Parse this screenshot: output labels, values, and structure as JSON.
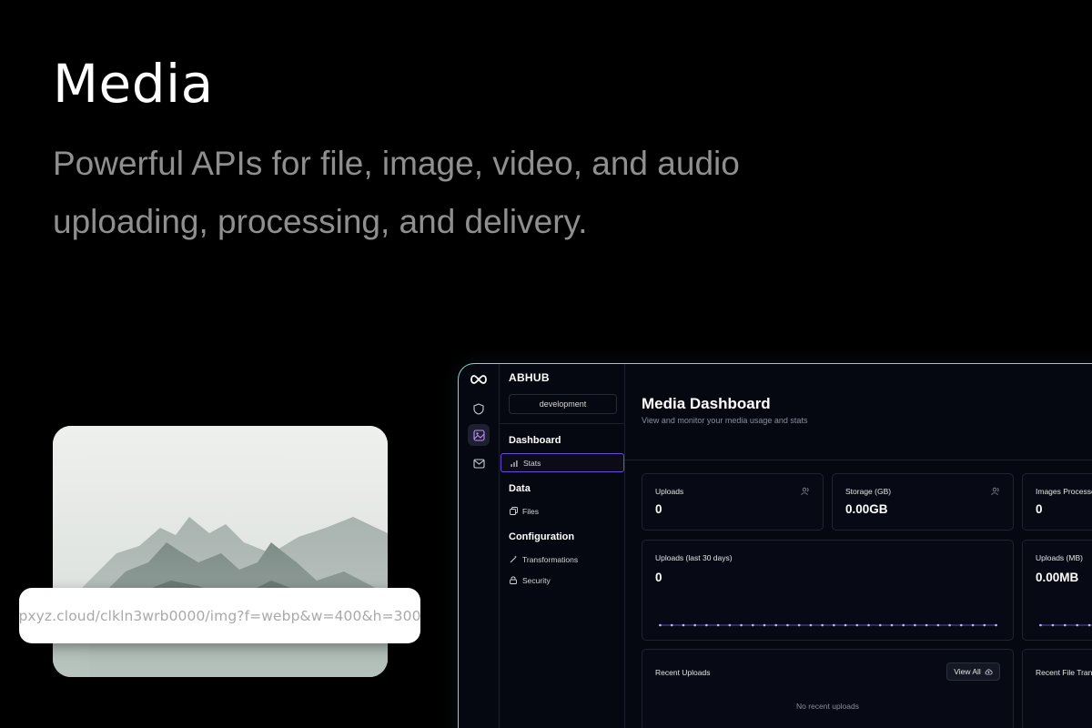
{
  "hero": {
    "title": "Media",
    "subtitle": "Powerful APIs for file, image, video, and audio uploading, processing, and delivery."
  },
  "image_card": {
    "url": "pxyz.cloud/clkln3wrb0000/img?f=webp&w=400&h=300"
  },
  "app": {
    "rail_icons": [
      "infinity-logo-icon",
      "shield-icon",
      "image-icon",
      "mail-icon"
    ],
    "org_name": "ABHUB",
    "environment": "development",
    "sidebar": {
      "dashboard_title": "Dashboard",
      "stats_label": "Stats",
      "data_title": "Data",
      "files_label": "Files",
      "config_title": "Configuration",
      "transformations_label": "Transformations",
      "security_label": "Security"
    },
    "main": {
      "title": "Media Dashboard",
      "subtitle": "View and monitor your media usage and stats",
      "stats": [
        {
          "label": "Uploads",
          "value": "0"
        },
        {
          "label": "Storage (GB)",
          "value": "0.00GB"
        },
        {
          "label": "Images Processe",
          "value": "0"
        }
      ],
      "uploads_chart": {
        "label": "Uploads (last 30 days)",
        "value": "0"
      },
      "uploads_mb": {
        "label": "Uploads (MB)",
        "value": "0.00MB"
      },
      "recent_uploads": {
        "label": "Recent Uploads",
        "view_all": "View All",
        "empty": "No recent uploads"
      },
      "recent_transforms": {
        "label": "Recent File Trans"
      }
    },
    "colors": {
      "accent": "#6b4bd1",
      "border_glow": "#8fd0c7"
    }
  }
}
